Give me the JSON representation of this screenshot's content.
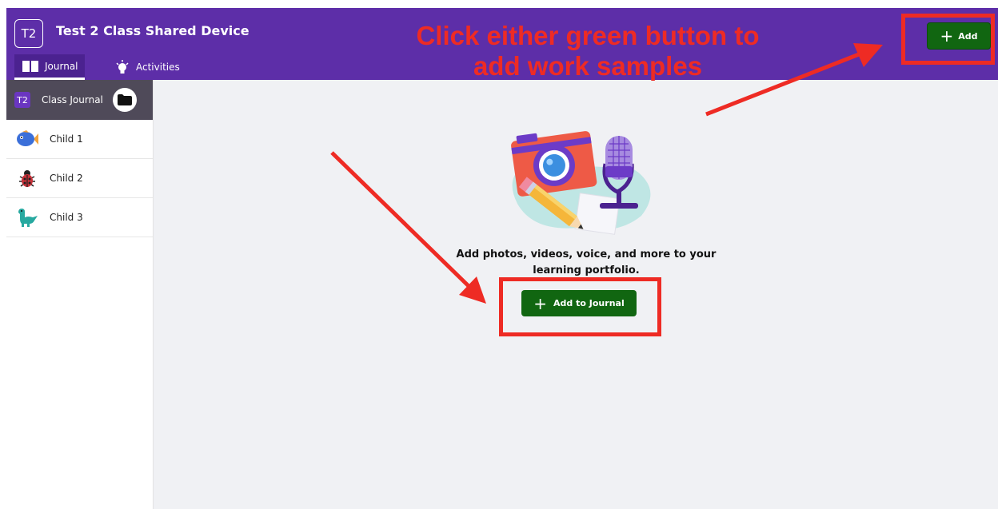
{
  "header": {
    "class_badge": "T2",
    "class_title": "Test 2 Class Shared Device",
    "tabs": [
      {
        "label": "Journal",
        "icon": "book-icon",
        "active": true
      },
      {
        "label": "Activities",
        "icon": "lightbulb-icon",
        "active": false
      }
    ],
    "add_button_label": "Add"
  },
  "sidebar": {
    "class_journal": {
      "badge": "T2",
      "label": "Class Journal",
      "icon": "folder-icon"
    },
    "children": [
      {
        "label": "Child 1",
        "avatar": "fish-avatar"
      },
      {
        "label": "Child 2",
        "avatar": "ladybug-avatar"
      },
      {
        "label": "Child 3",
        "avatar": "dinosaur-avatar"
      }
    ]
  },
  "main": {
    "illustration": "camera-microphone-pencil-illustration",
    "message": "Add photos, videos, voice, and more to your learning portfolio.",
    "add_button_label": "Add to Journal"
  },
  "annotation": {
    "text": "Click either green button to add work samples"
  },
  "colors": {
    "header": "#5d2ea8",
    "green_button": "#116611",
    "annotation_red": "#ee2b24",
    "sidebar_selected": "#4f4a59"
  }
}
